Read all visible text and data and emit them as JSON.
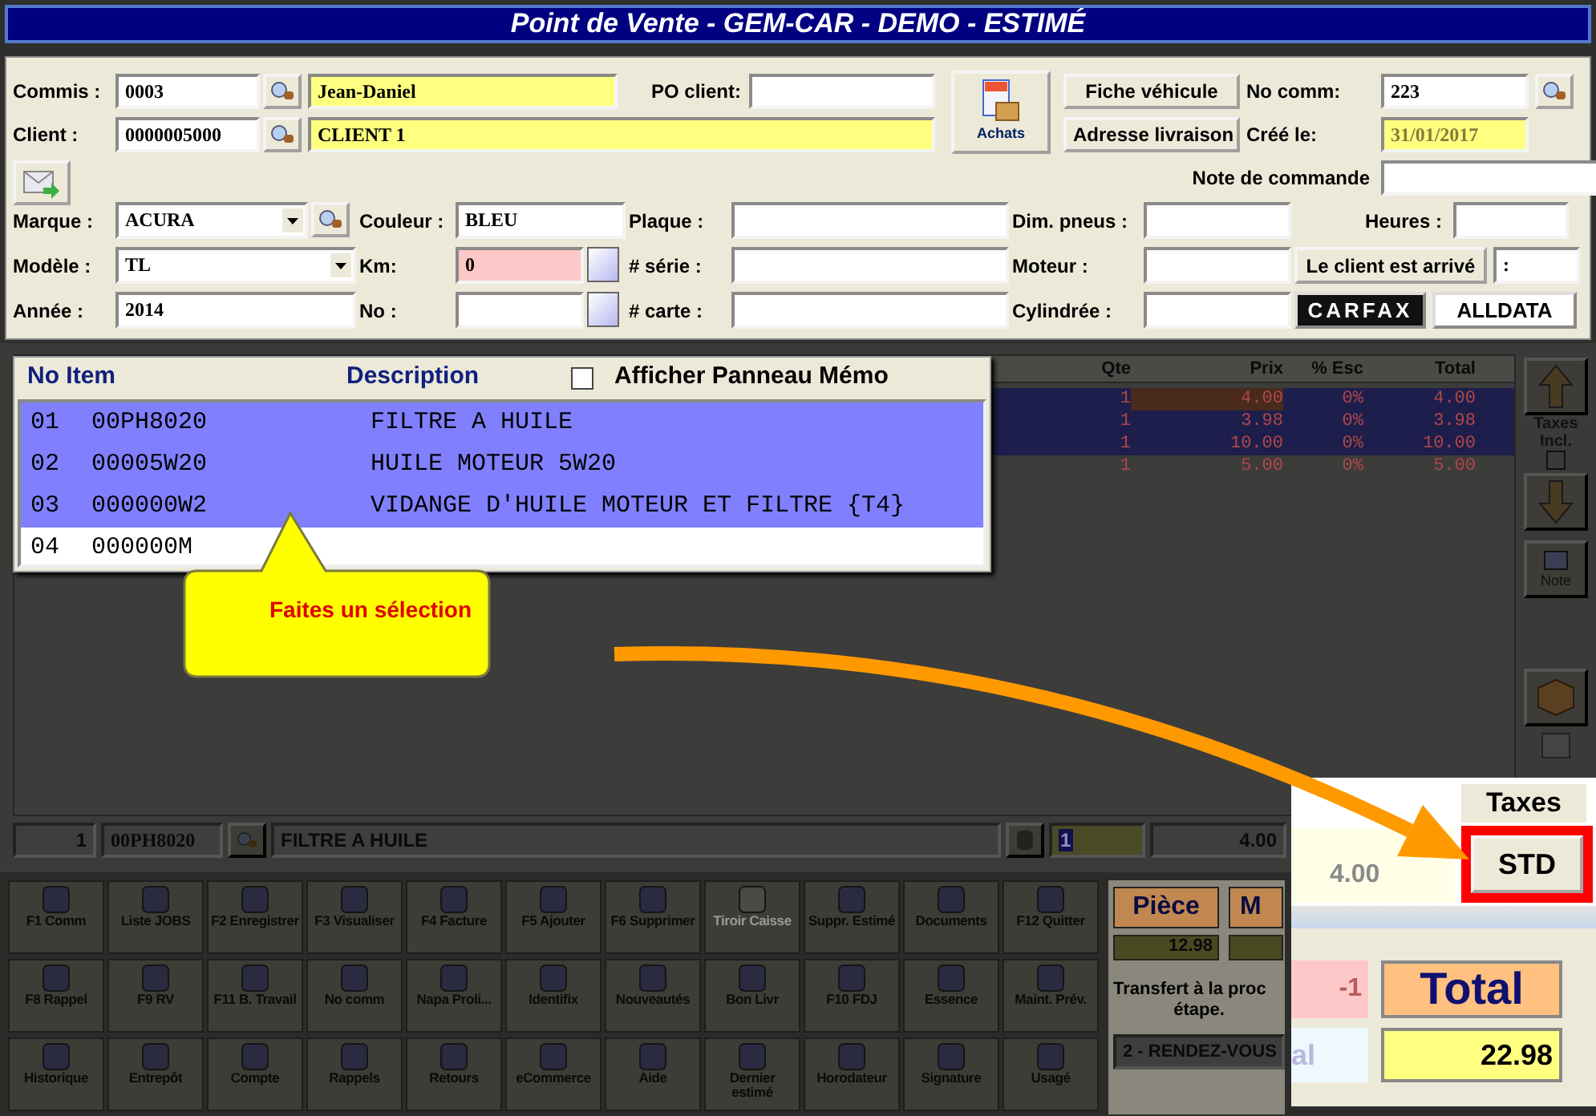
{
  "window": {
    "title": "Point de Vente - GEM-CAR - DEMO - ESTIMÉ"
  },
  "form": {
    "commis": {
      "label": "Commis :",
      "code": "0003",
      "name": "Jean-Daniel"
    },
    "po_client": {
      "label": "PO client:"
    },
    "client": {
      "label": "Client :",
      "code": "0000005000",
      "name": "CLIENT 1"
    },
    "achats_button": {
      "label": "Achats"
    },
    "fiche_button": {
      "label": "Fiche véhicule"
    },
    "adresse_button": {
      "label": "Adresse livraison"
    },
    "no_comm": {
      "label": "No comm:",
      "value": "223"
    },
    "cree_le": {
      "label": "Créé le:",
      "value": "31/01/2017"
    },
    "note": {
      "label": "Note de commande"
    },
    "marque": {
      "label": "Marque :",
      "value": "ACURA"
    },
    "couleur": {
      "label": "Couleur :",
      "value": "BLEU"
    },
    "plaque": {
      "label": "Plaque :"
    },
    "dim_pneus": {
      "label": "Dim. pneus :"
    },
    "heures": {
      "label": "Heures :"
    },
    "modele": {
      "label": "Modèle :",
      "value": "TL"
    },
    "km": {
      "label": "Km:",
      "value": "0"
    },
    "serie": {
      "label": "# série :"
    },
    "moteur": {
      "label": "Moteur :"
    },
    "arrive_button": {
      "label": "Le client est arrivé"
    },
    "arrive_time": {
      "value": ":"
    },
    "annee": {
      "label": "Année :",
      "value": "2014"
    },
    "no": {
      "label": "No :"
    },
    "carte": {
      "label": "# carte :"
    },
    "cylindree": {
      "label": "Cylindrée :"
    },
    "carfax": {
      "label": "CARFAX"
    },
    "alldata": {
      "label": "ALLDATA"
    }
  },
  "grid": {
    "columns": [
      "Qte",
      "Prix",
      "% Esc",
      "Total"
    ],
    "rows": [
      {
        "qte": "1",
        "prix": "4.00",
        "esc": "0%",
        "total": "4.00",
        "selected": true
      },
      {
        "qte": "1",
        "prix": "3.98",
        "esc": "0%",
        "total": "3.98",
        "selected": true
      },
      {
        "qte": "1",
        "prix": "10.00",
        "esc": "0%",
        "total": "10.00",
        "selected": true
      },
      {
        "qte": "1",
        "prix": "5.00",
        "esc": "0%",
        "total": "5.00",
        "selected": false
      }
    ]
  },
  "side_toolbar": {
    "taxes_label": "Taxes Incl.",
    "taxes_checked": false,
    "box_checked": false,
    "note_label": "Note"
  },
  "entry": {
    "line": "1",
    "item": "00PH8020",
    "description": "FILTRE A HUILE",
    "qty": "1",
    "price": "4.00"
  },
  "popup": {
    "columns": [
      "No Item",
      "Description"
    ],
    "memo": {
      "label": "Afficher Panneau Mémo",
      "checked": false
    },
    "rows": [
      {
        "no": "01",
        "item": "00PH8020",
        "description": "FILTRE A HUILE",
        "selected": true
      },
      {
        "no": "02",
        "item": "00005W20",
        "description": "HUILE MOTEUR 5W20",
        "selected": true
      },
      {
        "no": "03",
        "item": "000000W2",
        "description": "VIDANGE D'HUILE MOTEUR ET FILTRE {T4}",
        "selected": true
      },
      {
        "no": "04",
        "item": "000000M",
        "selected": false
      }
    ]
  },
  "callout": {
    "text": "Faites un sélection"
  },
  "toolbar": [
    {
      "label": "F1 Comm",
      "disabled": false
    },
    {
      "label": "Liste JOBS",
      "disabled": false
    },
    {
      "label": "F2 Enregistrer",
      "disabled": false
    },
    {
      "label": "F3 Visualiser",
      "disabled": false
    },
    {
      "label": "F4 Facture",
      "disabled": false
    },
    {
      "label": "F5 Ajouter",
      "disabled": false
    },
    {
      "label": "F6 Supprimer",
      "disabled": false
    },
    {
      "label": "Tiroir Caisse",
      "disabled": true
    },
    {
      "label": "Suppr. Estimé",
      "disabled": false
    },
    {
      "label": "Documents",
      "disabled": false
    },
    {
      "label": "F12 Quitter",
      "disabled": false
    },
    {
      "label": "F8 Rappel",
      "disabled": false
    },
    {
      "label": "F9 RV",
      "disabled": false
    },
    {
      "label": "F11 B. Travail",
      "disabled": false
    },
    {
      "label": "No comm",
      "disabled": false
    },
    {
      "label": "Napa Proli...",
      "disabled": false
    },
    {
      "label": "Identifix",
      "disabled": false
    },
    {
      "label": "Nouveautés",
      "disabled": false
    },
    {
      "label": "Bon Livr",
      "disabled": false
    },
    {
      "label": "F10  FDJ",
      "disabled": false
    },
    {
      "label": "Essence",
      "disabled": false
    },
    {
      "label": "Maint. Prév.",
      "disabled": false
    },
    {
      "label": "Historique",
      "disabled": false
    },
    {
      "label": "Entrepôt",
      "disabled": false
    },
    {
      "label": "Compte",
      "disabled": false
    },
    {
      "label": "Rappels",
      "disabled": false
    },
    {
      "label": "Retours",
      "disabled": false
    },
    {
      "label": "eCommerce",
      "disabled": false
    },
    {
      "label": "Aide",
      "disabled": false
    },
    {
      "label": "Dernier estimé",
      "disabled": false
    },
    {
      "label": "Horodateur",
      "disabled": false
    },
    {
      "label": "Signature",
      "disabled": false
    },
    {
      "label": "Usagé",
      "disabled": false
    }
  ],
  "summary": {
    "piece_label": "Pièce",
    "second_label": "M",
    "piece_value": "12.98",
    "transfer_lines": [
      "Transfert à la proc",
      "étape."
    ],
    "stage": "2 - RENDEZ-VOUS"
  },
  "inset": {
    "taxes_label": "Taxes",
    "std_button": "STD",
    "price": "4.00",
    "discount": "-1",
    "total_label": "Total",
    "subtotal_fragment": "al",
    "total": "22.98"
  }
}
